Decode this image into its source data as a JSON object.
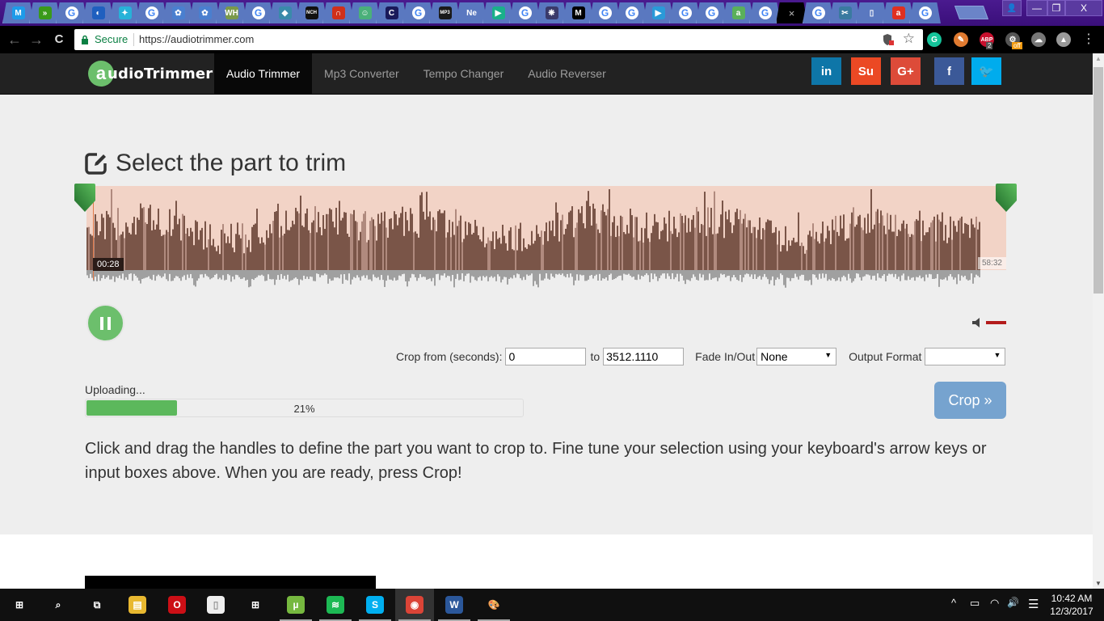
{
  "browser": {
    "tabs": [
      {
        "icon": "m-icon",
        "glyph": "M",
        "color": "#1e9be9"
      },
      {
        "icon": "fast-forward-icon",
        "glyph": "»",
        "color": "#3a9a1a"
      },
      {
        "icon": "google-icon",
        "glyph": "G",
        "color": "g"
      },
      {
        "icon": "blue-swirl-icon",
        "glyph": "◐",
        "color": "#1f5fbf"
      },
      {
        "icon": "runner-icon",
        "glyph": "✦",
        "color": "#27b2d8"
      },
      {
        "icon": "google-icon",
        "glyph": "G",
        "color": "g"
      },
      {
        "icon": "puzzle-icon",
        "glyph": "✿",
        "color": "#4a7fcf"
      },
      {
        "icon": "puzzle-icon",
        "glyph": "✿",
        "color": "#4a7fcf"
      },
      {
        "icon": "wh-icon",
        "glyph": "WH",
        "color": "#7a9a4a"
      },
      {
        "icon": "google-icon",
        "glyph": "G",
        "color": "g"
      },
      {
        "icon": "pen-icon",
        "glyph": "◆",
        "color": "#3a8aaa"
      },
      {
        "icon": "nch-icon",
        "glyph": "NCH",
        "color": "#111111"
      },
      {
        "icon": "headphones-icon",
        "glyph": "∩",
        "color": "#d0301a"
      },
      {
        "icon": "robot-icon",
        "glyph": "☺",
        "color": "#4ab07a"
      },
      {
        "icon": "c-icon",
        "glyph": "C",
        "color": "#1a1a5a"
      },
      {
        "icon": "google-icon",
        "glyph": "G",
        "color": "g"
      },
      {
        "icon": "mp3-icon",
        "glyph": "MP3",
        "color": "#1a1a1a"
      },
      {
        "icon": "ne-icon",
        "glyph": "Ne",
        "color": "transparent"
      },
      {
        "icon": "play-icon",
        "glyph": "▶",
        "color": "#1ab08a"
      },
      {
        "icon": "google-icon",
        "glyph": "G",
        "color": "g"
      },
      {
        "icon": "snowflake-icon",
        "glyph": "❋",
        "color": "#3a3a6a"
      },
      {
        "icon": "medium-icon",
        "glyph": "M",
        "color": "#000000"
      },
      {
        "icon": "google-icon",
        "glyph": "G",
        "color": "g"
      },
      {
        "icon": "google-icon",
        "glyph": "G",
        "color": "g"
      },
      {
        "icon": "play-store-icon",
        "glyph": "▶",
        "color": "#2a9ad8"
      },
      {
        "icon": "google-icon",
        "glyph": "G",
        "color": "g"
      },
      {
        "icon": "google-icon",
        "glyph": "G",
        "color": "g"
      },
      {
        "icon": "green-a-icon",
        "glyph": "a",
        "color": "#5ab05a"
      },
      {
        "icon": "google-icon",
        "glyph": "G",
        "color": "g"
      },
      {
        "icon": "close-icon",
        "glyph": "×",
        "color": "active"
      },
      {
        "icon": "google-icon",
        "glyph": "G",
        "color": "g"
      },
      {
        "icon": "scissors-icon",
        "glyph": "✂",
        "color": "#3a7aa0"
      },
      {
        "icon": "document-icon",
        "glyph": "▯",
        "color": "transparent"
      },
      {
        "icon": "red-a-icon",
        "glyph": "a",
        "color": "#e03020"
      },
      {
        "icon": "google-icon",
        "glyph": "G",
        "color": "g"
      }
    ],
    "window_controls": {
      "user": "👤",
      "minimize": "—",
      "restore": "❐",
      "close": "X"
    },
    "nav": {
      "back": "←",
      "forward": "→",
      "reload": "C"
    },
    "secure_label": "Secure",
    "url": "https://audiotrimmer.com",
    "extensions": [
      {
        "name": "grammarly-icon",
        "glyph": "G",
        "color": "#15c39a"
      },
      {
        "name": "tag-icon",
        "glyph": "✎",
        "color": "#e07a30"
      },
      {
        "name": "adblock-plus-icon",
        "glyph": "ABP",
        "color": "#c8102e",
        "badge": "2"
      },
      {
        "name": "extension-gear-icon",
        "glyph": "⚙",
        "color": "#555555",
        "badge": "off"
      },
      {
        "name": "cloud-download-icon",
        "glyph": "☁",
        "color": "#777777"
      },
      {
        "name": "google-drive-icon",
        "glyph": "▲",
        "color": "#999999"
      }
    ],
    "menu_glyph": "⋮"
  },
  "site": {
    "logo_letter": "a",
    "logo_text": "udioTrimmer",
    "nav": [
      {
        "label": "Audio Trimmer",
        "active": true
      },
      {
        "label": "Mp3 Converter",
        "active": false
      },
      {
        "label": "Tempo Changer",
        "active": false
      },
      {
        "label": "Audio Reverser",
        "active": false
      }
    ],
    "social": [
      {
        "name": "linkedin",
        "glyph": "in",
        "color": "#0e76a8"
      },
      {
        "name": "stumbleupon",
        "glyph": "Su",
        "color": "#eb4924"
      },
      {
        "name": "google-plus",
        "glyph": "G+",
        "color": "#dd4b39"
      },
      {
        "name": "facebook",
        "glyph": "f",
        "color": "#3b5998"
      },
      {
        "name": "twitter",
        "glyph": "🐦",
        "color": "#00aced"
      }
    ]
  },
  "trimmer": {
    "title": "Select the part to trim",
    "current_time": "00:28",
    "end_time": "58:32",
    "crop_from_label": "Crop from (seconds):",
    "crop_from_value": "0",
    "to_label": "to",
    "crop_to_value": "3512.1110",
    "fade_label": "Fade In/Out",
    "fade_value": "None",
    "output_format_label": "Output Format",
    "output_format_value": "",
    "uploading_label": "Uploading...",
    "upload_progress": 21,
    "upload_progress_text": "21%",
    "crop_button": "Crop »",
    "instructions": "Click and drag the handles to define the part you want to crop to. Fine tune your selection using your keyboard's arrow keys or input boxes above. When you are ready, press Crop!",
    "colors": {
      "selection": "#f2d3c6",
      "wave_dark": "#7a5548",
      "wave_light": "#b08a7e",
      "wave_reflection": "#a0a0a0",
      "handle": "#3a9a48",
      "progress": "#5cb85c",
      "volume": "#b31b1b"
    }
  },
  "taskbar": {
    "items": [
      {
        "name": "start-button",
        "glyph": "⊞",
        "color": "transparent"
      },
      {
        "name": "search-icon",
        "glyph": "⌕",
        "color": "transparent"
      },
      {
        "name": "task-view-icon",
        "glyph": "⧉",
        "color": "transparent"
      },
      {
        "name": "file-explorer-icon",
        "glyph": "▤",
        "color": "#e8b830"
      },
      {
        "name": "opera-icon",
        "glyph": "O",
        "color": "#cc0f16"
      },
      {
        "name": "blank-document-icon",
        "glyph": "▯",
        "color": "#eeeeee"
      },
      {
        "name": "store-icon",
        "glyph": "⊞",
        "color": "transparent"
      },
      {
        "name": "utorrent-icon",
        "glyph": "µ",
        "color": "#76b83f"
      },
      {
        "name": "spotify-icon",
        "glyph": "≋",
        "color": "#1db954"
      },
      {
        "name": "skype-icon",
        "glyph": "S",
        "color": "#00aff0"
      },
      {
        "name": "chrome-icon",
        "glyph": "◉",
        "color": "#db4437"
      },
      {
        "name": "word-icon",
        "glyph": "W",
        "color": "#2b579a"
      },
      {
        "name": "paint-icon",
        "glyph": "🎨",
        "color": "transparent"
      }
    ],
    "tray": {
      "chevron": "^",
      "battery": "▭",
      "wifi": "◠",
      "volume": "🔊",
      "notifications": "☰",
      "time": "10:42 AM",
      "date": "12/3/2017"
    }
  }
}
